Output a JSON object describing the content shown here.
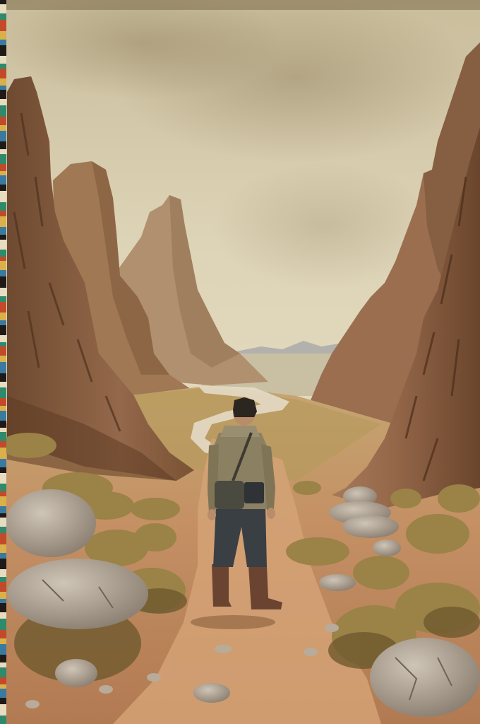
{
  "scene": {
    "palette": {
      "sky_top": "#cfc4a4",
      "sky_mid": "#ddd3b6",
      "haze": "#e6dcc0",
      "distant_mountain": "#9aa0a6",
      "far_spire": "#a88b6c",
      "mid_spire": "#9c7454",
      "cliff_left": "#8a5e3c",
      "cliff_right": "#86583a",
      "cliff_shadow": "#5e3c24",
      "ground": "#c08f62",
      "ground_dark": "#9d6c46",
      "path": "#d6ad80",
      "river": "#e2dcc8",
      "grass": "#a38a4e",
      "grass_dark": "#6f5a2e",
      "boulder": "#b3a89a",
      "boulder_shadow": "#7c7064",
      "jacket": "#8c8062",
      "pants": "#3a3f44",
      "boots": "#6a4430",
      "skin": "#b98d6a",
      "hair": "#2c2620",
      "bag": "#4a4a40"
    },
    "film_strip_colors": [
      "#c24a2a",
      "#2e8a6a",
      "#e8dcc0",
      "#1f1a18",
      "#3a7aa0",
      "#d9b04a"
    ]
  }
}
